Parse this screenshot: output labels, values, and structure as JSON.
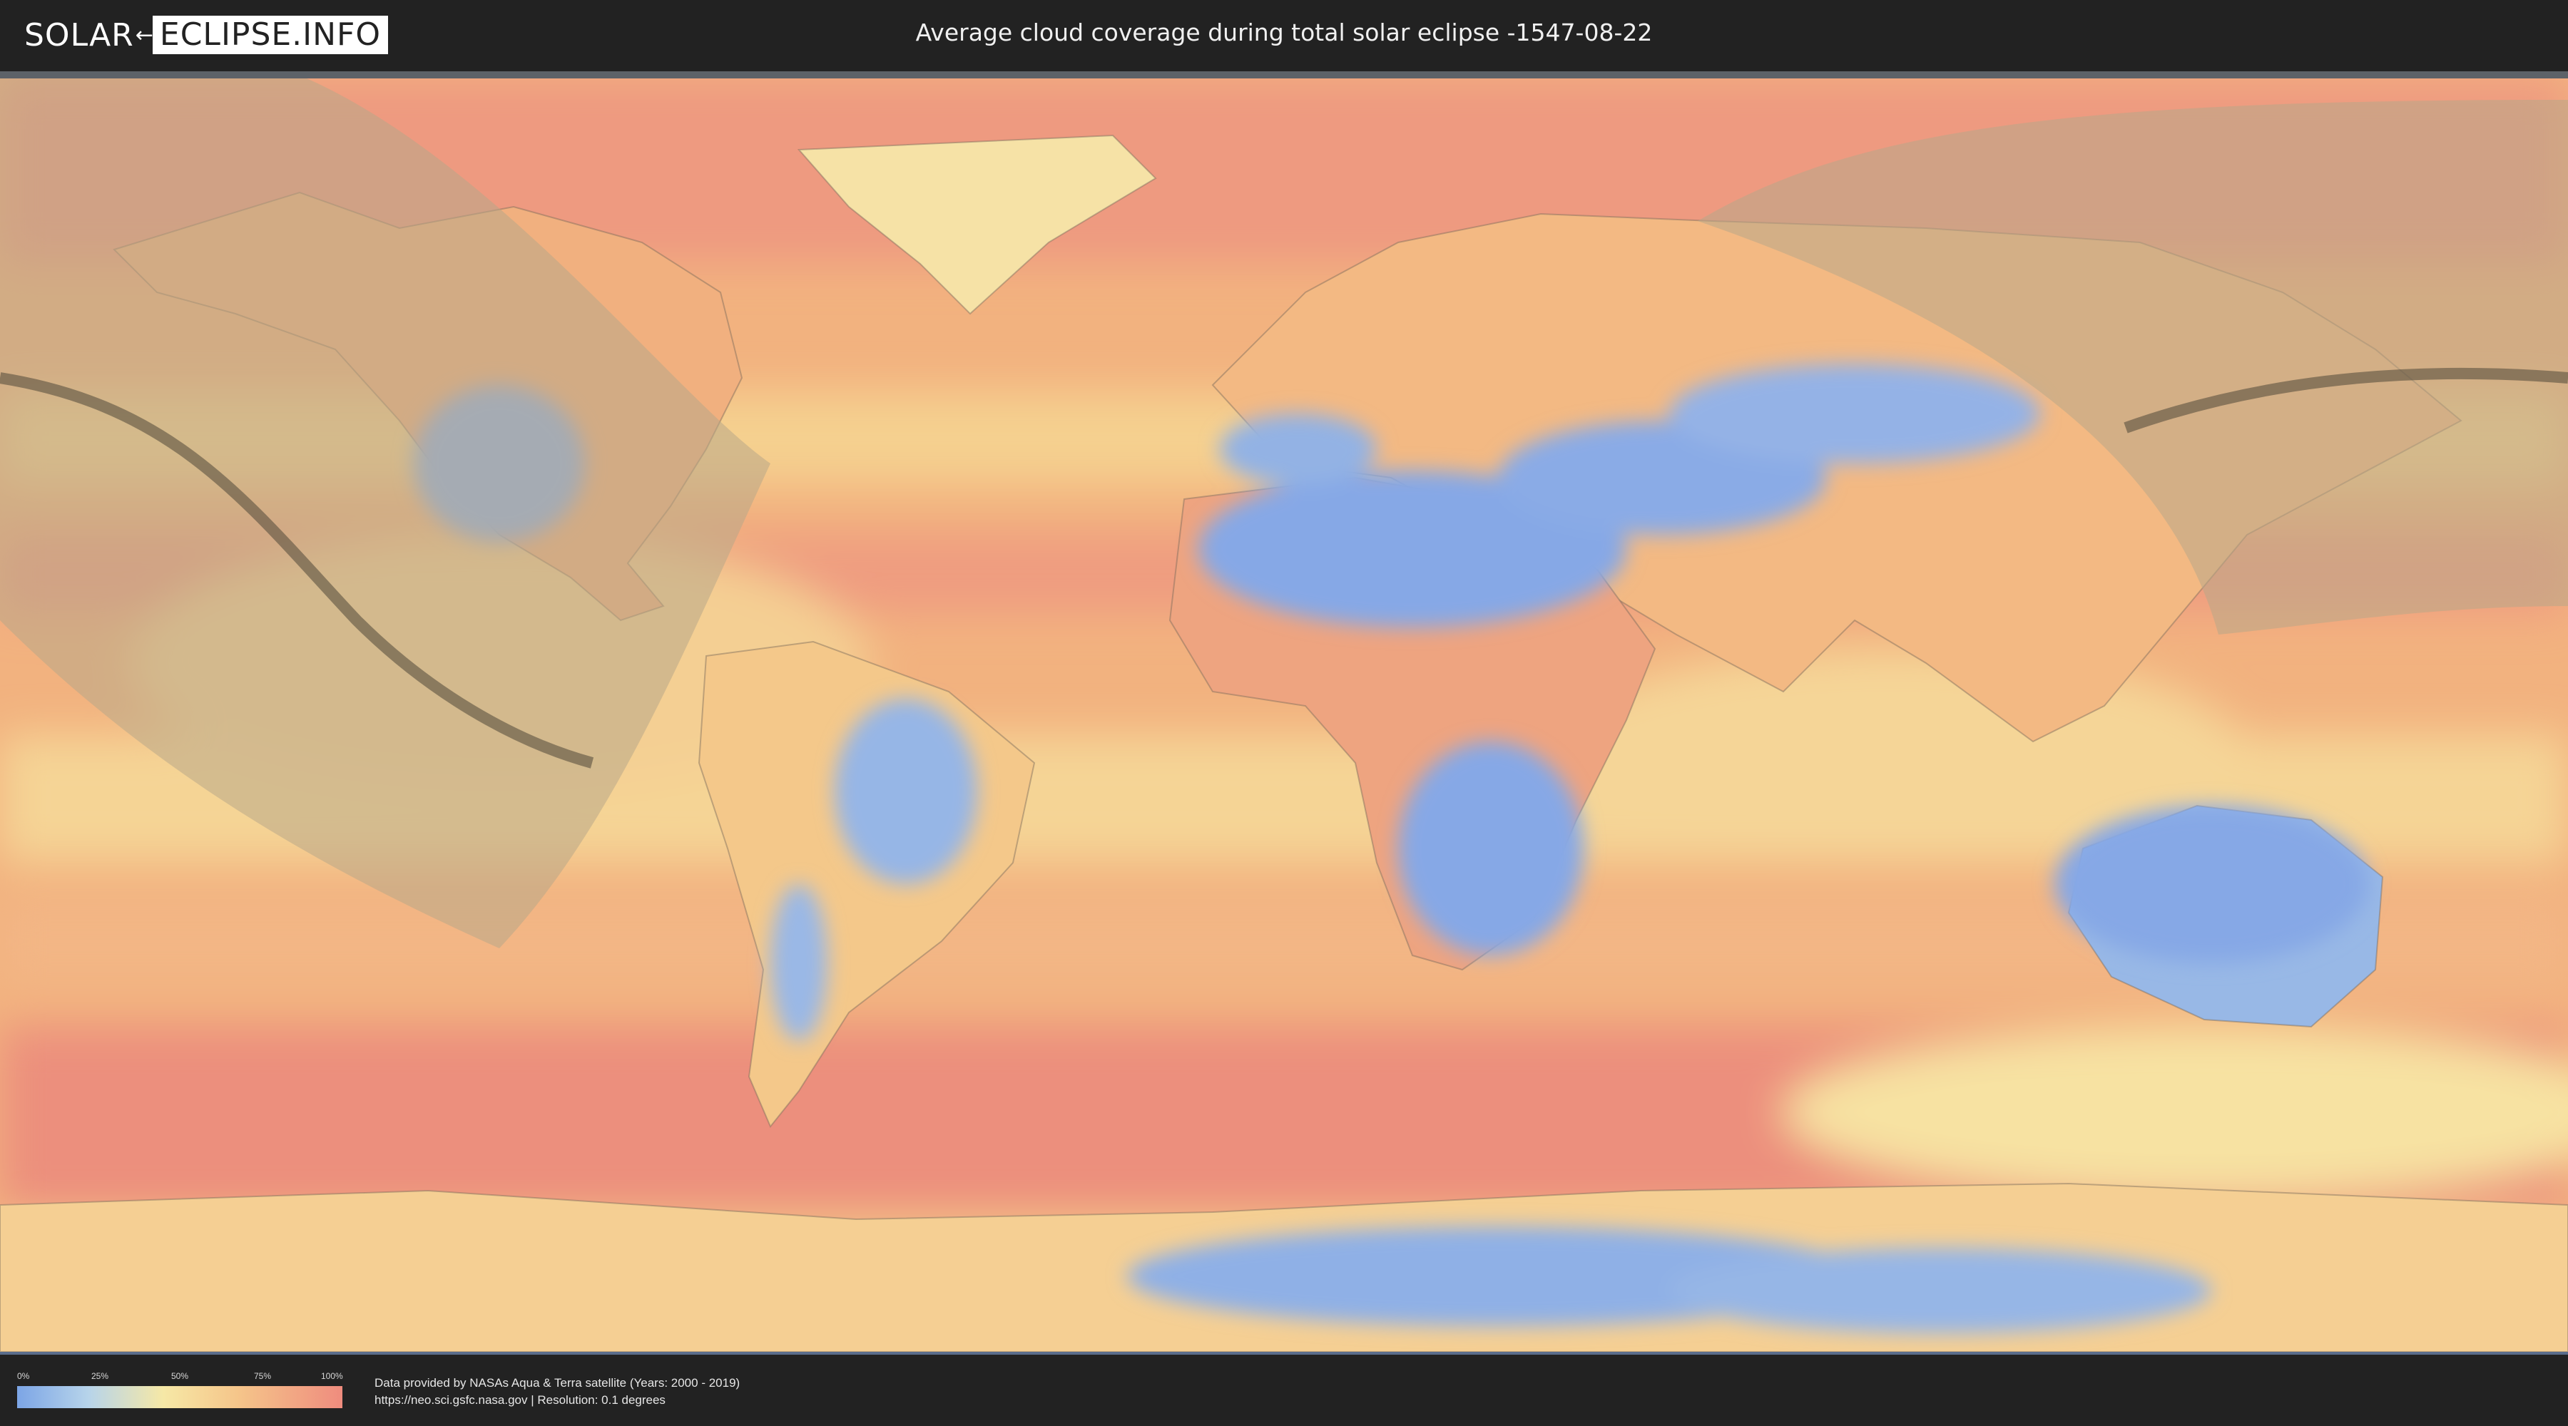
{
  "site": {
    "logo_left": "SOLAR",
    "logo_right": "ECLIPSE.INFO",
    "logo_separator": "←"
  },
  "page_title": "Average cloud coverage during total solar eclipse -1547-08-22",
  "legend": {
    "ticks": [
      "0%",
      "25%",
      "50%",
      "75%",
      "100%"
    ],
    "gradient_colors": [
      "#7ca5e6",
      "#b7d4ea",
      "#f6e8a6",
      "#f5c58a",
      "#ef8c7e"
    ]
  },
  "credits": {
    "line1": "Data provided by NASAs Aqua & Terra satellite (Years: 2000 - 2019)",
    "line2": "https://neo.sci.gsfc.nasa.gov | Resolution: 0.1 degrees"
  },
  "map": {
    "projection": "equirectangular world map",
    "layer": "cloud coverage heatmap",
    "overlays": [
      "eclipse visibility zone",
      "path of totality centre line"
    ],
    "colors": {
      "clear": "#7ca5e6",
      "low": "#b7d4ea",
      "medium": "#f6e8a6",
      "high": "#f5c58a",
      "overcast": "#ef8c7e",
      "eclipse_zone": "#a89a78",
      "totality_path": "#5a5040"
    }
  }
}
